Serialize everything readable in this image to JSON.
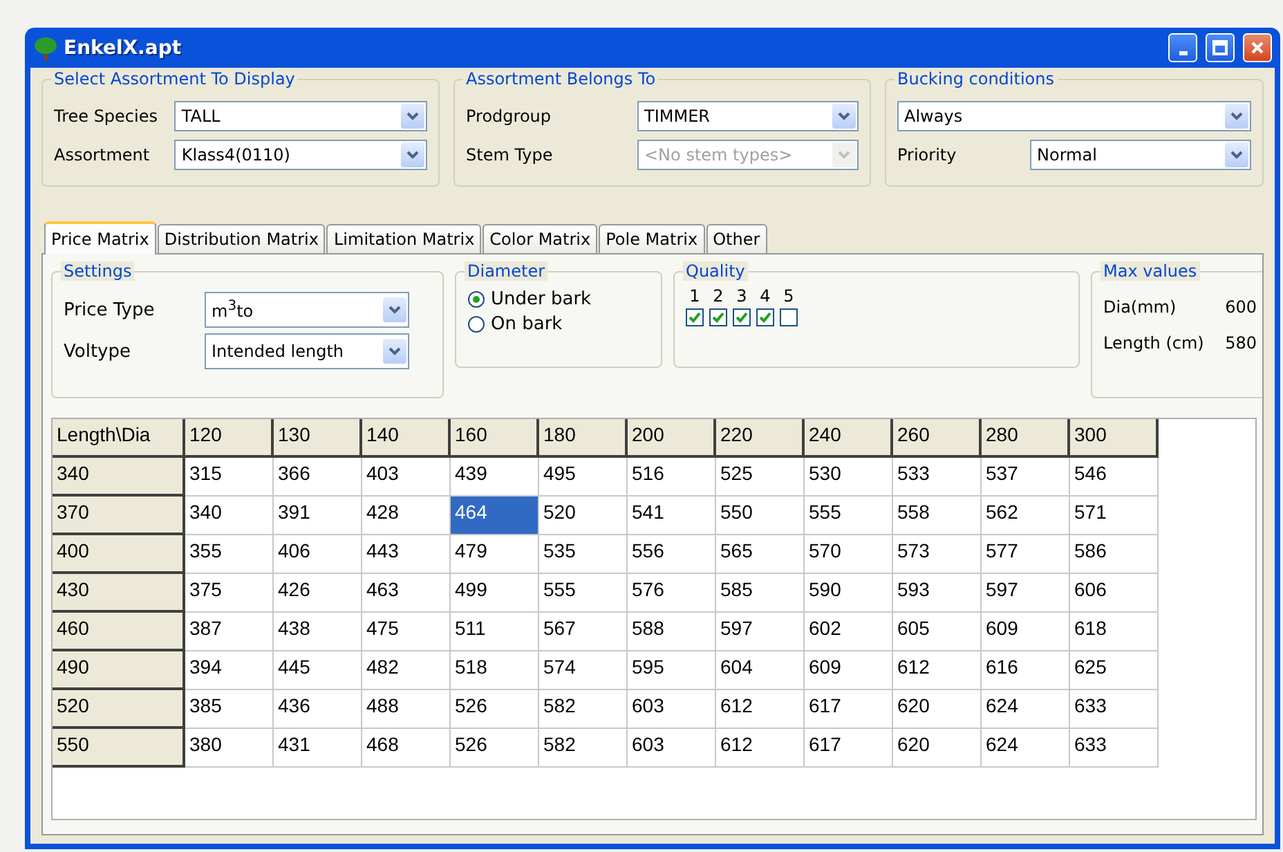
{
  "window": {
    "title": "EnkelX.apt"
  },
  "assortment_group": {
    "title": "Select Assortment To Display",
    "fields": [
      {
        "label": "Tree Species",
        "value": "TALL",
        "disabled": false
      },
      {
        "label": "Assortment",
        "value": "Klass4(0110)",
        "disabled": false
      }
    ]
  },
  "belongs_group": {
    "title": "Assortment Belongs To",
    "fields": [
      {
        "label": "Prodgroup",
        "value": "TIMMER",
        "disabled": false
      },
      {
        "label": "Stem Type",
        "value": "<No stem types>",
        "disabled": true
      }
    ]
  },
  "bucking_group": {
    "title": "Bucking conditions",
    "condition": {
      "value": "Always",
      "disabled": false
    },
    "priority": {
      "label": "Priority",
      "value": "Normal",
      "disabled": false
    }
  },
  "tabs": [
    {
      "label": "Price Matrix",
      "selected": true
    },
    {
      "label": "Distribution Matrix",
      "selected": false
    },
    {
      "label": "Limitation Matrix",
      "selected": false
    },
    {
      "label": "Color Matrix",
      "selected": false
    },
    {
      "label": "Pole Matrix",
      "selected": false
    },
    {
      "label": "Other",
      "selected": false
    }
  ],
  "settings": {
    "title": "Settings",
    "fields": [
      {
        "label": "Price Type",
        "value": "m$^{3}$to",
        "disabled": false
      },
      {
        "label": "Voltype",
        "value": "Intended length",
        "disabled": false
      }
    ]
  },
  "diameter": {
    "title": "Diameter",
    "options": [
      {
        "label": "Under bark",
        "selected": true
      },
      {
        "label": "On bark",
        "selected": false
      }
    ]
  },
  "quality": {
    "title": "Quality",
    "levels": [
      {
        "label": "1",
        "checked": true
      },
      {
        "label": "2",
        "checked": true
      },
      {
        "label": "3",
        "checked": true
      },
      {
        "label": "4",
        "checked": true
      },
      {
        "label": "5",
        "checked": false
      }
    ]
  },
  "max_values": {
    "title": "Max values",
    "items": [
      {
        "label": "Dia(mm)",
        "value": "600"
      },
      {
        "label": "Length (cm)",
        "value": "580"
      }
    ]
  },
  "table": {
    "corner": "Length\\Dia",
    "columns": [
      "120",
      "130",
      "140",
      "160",
      "180",
      "200",
      "220",
      "240",
      "260",
      "280",
      "300"
    ],
    "rows": [
      {
        "header": "340",
        "cells": [
          {
            "value": "315",
            "selected": false
          },
          {
            "value": "366",
            "selected": false
          },
          {
            "value": "403",
            "selected": false
          },
          {
            "value": "439",
            "selected": false
          },
          {
            "value": "495",
            "selected": false
          },
          {
            "value": "516",
            "selected": false
          },
          {
            "value": "525",
            "selected": false
          },
          {
            "value": "530",
            "selected": false
          },
          {
            "value": "533",
            "selected": false
          },
          {
            "value": "537",
            "selected": false
          },
          {
            "value": "546",
            "selected": false
          }
        ]
      },
      {
        "header": "370",
        "cells": [
          {
            "value": "340",
            "selected": false
          },
          {
            "value": "391",
            "selected": false
          },
          {
            "value": "428",
            "selected": false
          },
          {
            "value": "464",
            "selected": true
          },
          {
            "value": "520",
            "selected": false
          },
          {
            "value": "541",
            "selected": false
          },
          {
            "value": "550",
            "selected": false
          },
          {
            "value": "555",
            "selected": false
          },
          {
            "value": "558",
            "selected": false
          },
          {
            "value": "562",
            "selected": false
          },
          {
            "value": "571",
            "selected": false
          }
        ]
      },
      {
        "header": "400",
        "cells": [
          {
            "value": "355",
            "selected": false
          },
          {
            "value": "406",
            "selected": false
          },
          {
            "value": "443",
            "selected": false
          },
          {
            "value": "479",
            "selected": false
          },
          {
            "value": "535",
            "selected": false
          },
          {
            "value": "556",
            "selected": false
          },
          {
            "value": "565",
            "selected": false
          },
          {
            "value": "570",
            "selected": false
          },
          {
            "value": "573",
            "selected": false
          },
          {
            "value": "577",
            "selected": false
          },
          {
            "value": "586",
            "selected": false
          }
        ]
      },
      {
        "header": "430",
        "cells": [
          {
            "value": "375",
            "selected": false
          },
          {
            "value": "426",
            "selected": false
          },
          {
            "value": "463",
            "selected": false
          },
          {
            "value": "499",
            "selected": false
          },
          {
            "value": "555",
            "selected": false
          },
          {
            "value": "576",
            "selected": false
          },
          {
            "value": "585",
            "selected": false
          },
          {
            "value": "590",
            "selected": false
          },
          {
            "value": "593",
            "selected": false
          },
          {
            "value": "597",
            "selected": false
          },
          {
            "value": "606",
            "selected": false
          }
        ]
      },
      {
        "header": "460",
        "cells": [
          {
            "value": "387",
            "selected": false
          },
          {
            "value": "438",
            "selected": false
          },
          {
            "value": "475",
            "selected": false
          },
          {
            "value": "511",
            "selected": false
          },
          {
            "value": "567",
            "selected": false
          },
          {
            "value": "588",
            "selected": false
          },
          {
            "value": "597",
            "selected": false
          },
          {
            "value": "602",
            "selected": false
          },
          {
            "value": "605",
            "selected": false
          },
          {
            "value": "609",
            "selected": false
          },
          {
            "value": "618",
            "selected": false
          }
        ]
      },
      {
        "header": "490",
        "cells": [
          {
            "value": "394",
            "selected": false
          },
          {
            "value": "445",
            "selected": false
          },
          {
            "value": "482",
            "selected": false
          },
          {
            "value": "518",
            "selected": false
          },
          {
            "value": "574",
            "selected": false
          },
          {
            "value": "595",
            "selected": false
          },
          {
            "value": "604",
            "selected": false
          },
          {
            "value": "609",
            "selected": false
          },
          {
            "value": "612",
            "selected": false
          },
          {
            "value": "616",
            "selected": false
          },
          {
            "value": "625",
            "selected": false
          }
        ]
      },
      {
        "header": "520",
        "cells": [
          {
            "value": "385",
            "selected": false
          },
          {
            "value": "436",
            "selected": false
          },
          {
            "value": "488",
            "selected": false
          },
          {
            "value": "526",
            "selected": false
          },
          {
            "value": "582",
            "selected": false
          },
          {
            "value": "603",
            "selected": false
          },
          {
            "value": "612",
            "selected": false
          },
          {
            "value": "617",
            "selected": false
          },
          {
            "value": "620",
            "selected": false
          },
          {
            "value": "624",
            "selected": false
          },
          {
            "value": "633",
            "selected": false
          }
        ]
      },
      {
        "header": "550",
        "cells": [
          {
            "value": "380",
            "selected": false
          },
          {
            "value": "431",
            "selected": false
          },
          {
            "value": "468",
            "selected": false
          },
          {
            "value": "526",
            "selected": false
          },
          {
            "value": "582",
            "selected": false
          },
          {
            "value": "603",
            "selected": false
          },
          {
            "value": "612",
            "selected": false
          },
          {
            "value": "617",
            "selected": false
          },
          {
            "value": "620",
            "selected": false
          },
          {
            "value": "624",
            "selected": false
          },
          {
            "value": "633",
            "selected": false
          }
        ]
      }
    ]
  }
}
